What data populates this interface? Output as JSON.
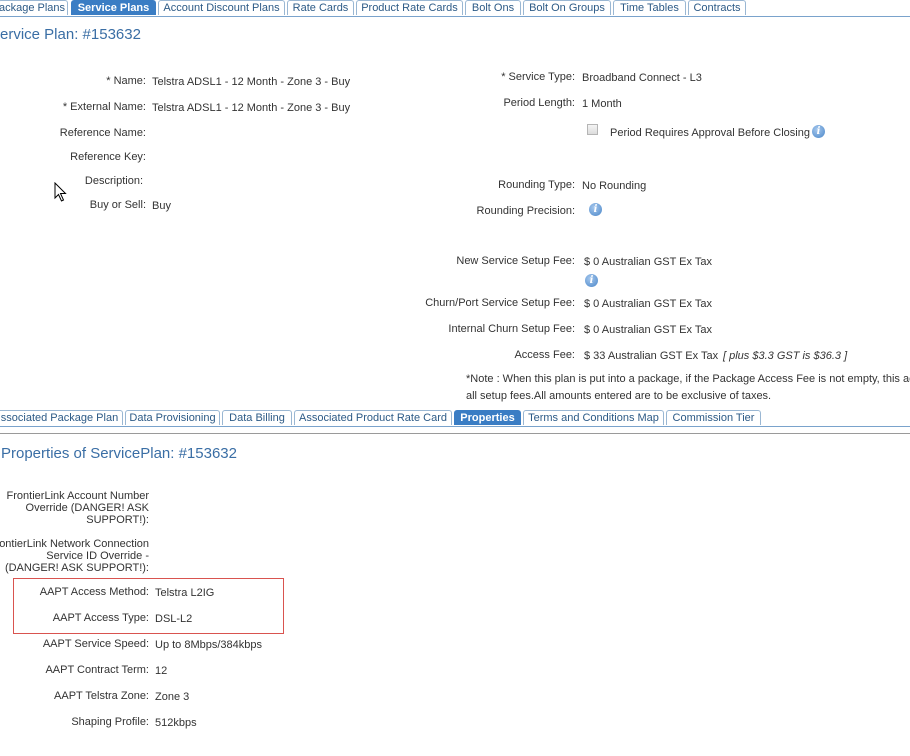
{
  "top_tabs": [
    {
      "label": "ackage Plans",
      "active": false
    },
    {
      "label": "Service Plans",
      "active": true
    },
    {
      "label": "Account Discount Plans",
      "active": false
    },
    {
      "label": "Rate Cards",
      "active": false
    },
    {
      "label": "Product Rate Cards",
      "active": false
    },
    {
      "label": "Bolt Ons",
      "active": false
    },
    {
      "label": "Bolt On Groups",
      "active": false
    },
    {
      "label": "Time Tables",
      "active": false
    },
    {
      "label": "Contracts",
      "active": false
    }
  ],
  "plan_title": "ervice Plan: #153632",
  "left_fields": {
    "name_label": "* Name:",
    "name_value": "Telstra ADSL1 - 12 Month - Zone 3 - Buy",
    "external_name_label": "* External Name:",
    "external_name_value": "Telstra ADSL1 - 12 Month - Zone 3 - Buy",
    "reference_name_label": "Reference Name:",
    "reference_key_label": "Reference Key:",
    "description_label": "Description:",
    "buy_sell_label": "Buy or Sell:",
    "buy_sell_value": "Buy"
  },
  "right_fields": {
    "service_type_label": "* Service Type:",
    "service_type_value": "Broadband Connect - L3",
    "period_length_label": "Period Length:",
    "period_length_value": "1 Month",
    "period_approval_label": "Period Requires Approval Before Closing",
    "rounding_type_label": "Rounding Type:",
    "rounding_type_value": "No Rounding",
    "rounding_precision_label": "Rounding Precision:",
    "new_setup_fee_label": "New Service Setup Fee:",
    "new_setup_fee_value": "$ 0 Australian GST Ex Tax",
    "churn_setup_fee_label": "Churn/Port Service Setup Fee:",
    "churn_setup_fee_value": "$ 0 Australian GST Ex Tax",
    "internal_churn_label": "Internal Churn Setup Fee:",
    "internal_churn_value": "$ 0 Australian GST Ex Tax",
    "access_fee_label": "Access Fee:",
    "access_fee_value": "$ 33 Australian GST Ex Tax",
    "access_fee_note": "[ plus $3.3 GST is $36.3 ]",
    "note_line1": "*Note : When this plan is put into a package, if the Package Access Fee is not empty, this acce",
    "note_line2": "all setup fees.All amounts entered are to be exclusive of taxes."
  },
  "sub_tabs": [
    {
      "label": "ssociated Package Plan",
      "active": false
    },
    {
      "label": "Data Provisioning",
      "active": false
    },
    {
      "label": "Data Billing",
      "active": false
    },
    {
      "label": "Associated Product Rate Card",
      "active": false
    },
    {
      "label": "Properties",
      "active": true
    },
    {
      "label": "Terms and Conditions Map",
      "active": false
    },
    {
      "label": "Commission Tier",
      "active": false
    }
  ],
  "properties_title": "Properties of ServicePlan: #153632",
  "properties": {
    "frontier_account_label": "FrontierLink Account Number Override (DANGER! ASK SUPPORT!):",
    "frontier_network_label": "rontierLink Network Connection Service ID Override - (DANGER! ASK SUPPORT!):",
    "aapt_access_method_label": "AAPT Access Method:",
    "aapt_access_method_value": "Telstra L2IG",
    "aapt_access_type_label": "AAPT Access Type:",
    "aapt_access_type_value": "DSL-L2",
    "aapt_service_speed_label": "AAPT Service Speed:",
    "aapt_service_speed_value": "Up to 8Mbps/384kbps",
    "aapt_contract_term_label": "AAPT Contract Term:",
    "aapt_contract_term_value": "12",
    "aapt_telstra_zone_label": "AAPT Telstra Zone:",
    "aapt_telstra_zone_value": "Zone 3",
    "shaping_profile_label": "Shaping Profile:",
    "shaping_profile_value": "512kbps"
  },
  "colors": {
    "active_tab": "#3a7dc4",
    "title_blue": "#3a6ea5",
    "highlight_red": "#d9534f"
  }
}
